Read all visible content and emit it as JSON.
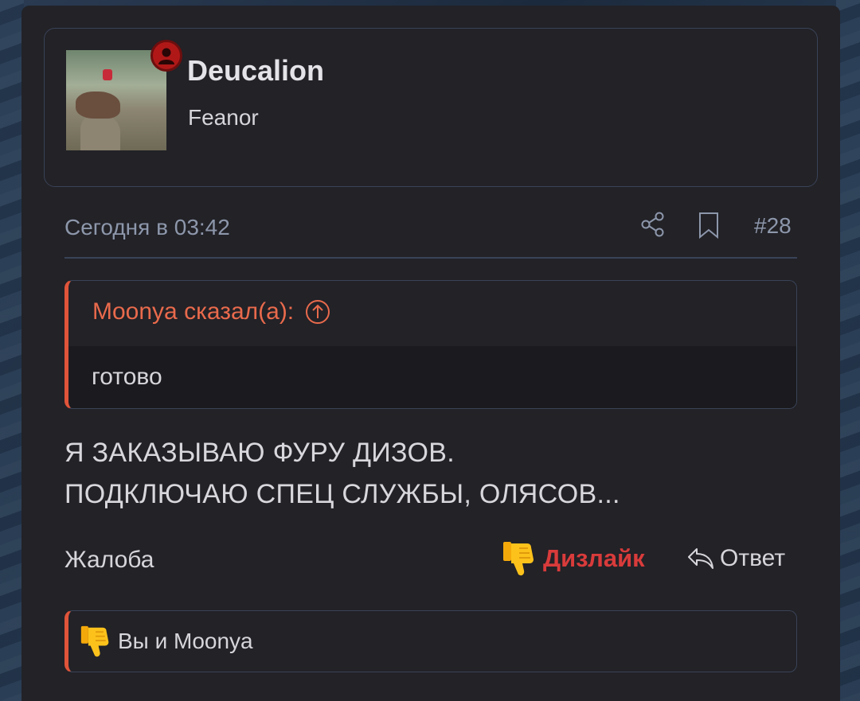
{
  "user": {
    "name": "Deucalion",
    "title": "Feanor",
    "avatar_icon": "user-avatar",
    "badge_icon": "online-user-icon",
    "badge_color": "#b01818"
  },
  "meta": {
    "date": "Сегодня в 03:42",
    "post_number": "#28",
    "share_icon": "share-icon",
    "bookmark_icon": "bookmark-icon"
  },
  "quote": {
    "author_line": "Moonya сказал(а):",
    "jump_icon": "arrow-up-circle-icon",
    "text": "готово",
    "accent_color": "#e0543a"
  },
  "message": {
    "line1": "Я ЗАКАЗЫВАЮ ФУРУ ДИЗОВ.",
    "line2": "ПОДКЛЮЧАЮ СПЕЦ СЛУЖБЫ, ОЛЯСОВ..."
  },
  "actions": {
    "report": "Жалоба",
    "dislike": "Дизлайк",
    "dislike_color": "#d93b3b",
    "reply": "Ответ"
  },
  "reactions": {
    "text": "Вы и Moonya",
    "icon": "thumbs-down-icon"
  }
}
